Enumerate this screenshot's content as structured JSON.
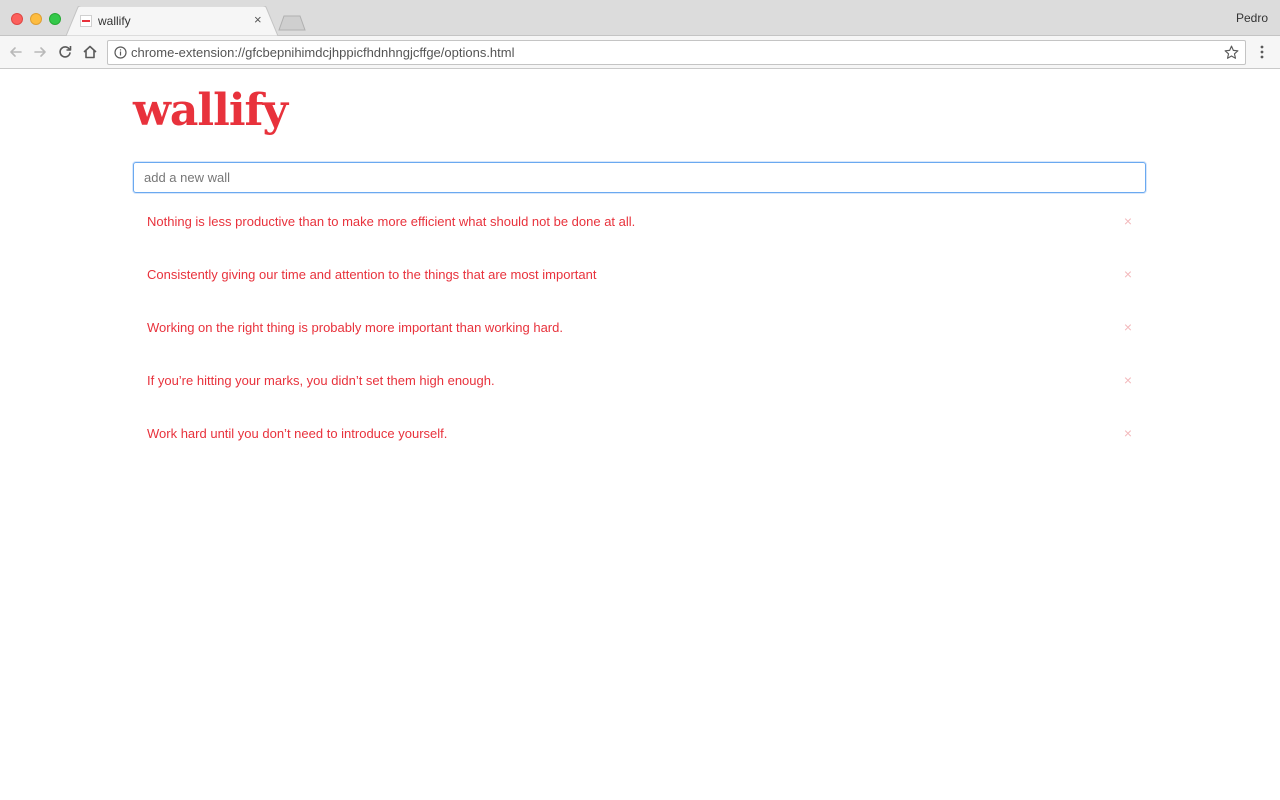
{
  "browser": {
    "tab_title": "wallify",
    "tab_close_glyph": "×",
    "profile_name": "Pedro",
    "url": "chrome-extension://gfcbepnihimdcjhppicfhdnhngjcffge/options.html",
    "icons": {
      "back": "arrow-left-icon",
      "forward": "arrow-right-icon",
      "reload": "reload-icon",
      "home": "home-icon",
      "info": "info-icon",
      "bookmark": "star-icon",
      "menu": "more-vertical-icon"
    }
  },
  "page": {
    "logo": "wallify",
    "input_placeholder": "add a new wall",
    "input_value": "",
    "remove_glyph": "×",
    "walls": [
      "Nothing is less productive than to make more efficient what should not be done at all.",
      "Consistently giving our time and attention to the things that are most important",
      "Working on the right thing is probably more important than working hard.",
      "If you’re hitting your marks, you didn’t set them high enough.",
      "Work hard until you don’t need to introduce yourself."
    ]
  },
  "colors": {
    "brand": "#e8323c",
    "remove": "#f3b9bc",
    "input_focus": "#6aa9f0"
  }
}
